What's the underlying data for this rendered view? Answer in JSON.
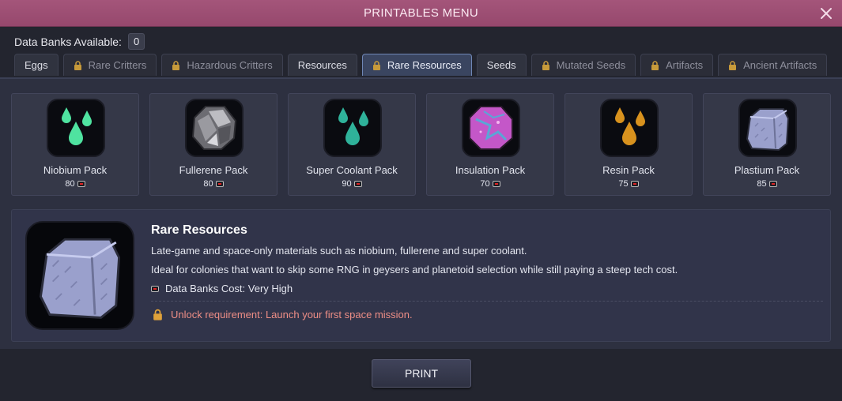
{
  "window": {
    "title": "PRINTABLES MENU"
  },
  "databanks": {
    "label": "Data Banks Available:",
    "count": "0"
  },
  "tabs": [
    {
      "label": "Eggs",
      "locked": false,
      "active": false
    },
    {
      "label": "Rare Critters",
      "locked": true,
      "active": false
    },
    {
      "label": "Hazardous Critters",
      "locked": true,
      "active": false
    },
    {
      "label": "Resources",
      "locked": false,
      "active": false
    },
    {
      "label": "Rare Resources",
      "locked": true,
      "active": true
    },
    {
      "label": "Seeds",
      "locked": false,
      "active": false
    },
    {
      "label": "Mutated Seeds",
      "locked": true,
      "active": false
    },
    {
      "label": "Artifacts",
      "locked": true,
      "active": false
    },
    {
      "label": "Ancient Artifacts",
      "locked": true,
      "active": false
    }
  ],
  "packs": [
    {
      "name": "Niobium Pack",
      "cost": "80",
      "icon": "green-drops-icon",
      "color": "#4fe3a0"
    },
    {
      "name": "Fullerene Pack",
      "cost": "80",
      "icon": "fullerene-rock-icon",
      "color": "#8a8a8f"
    },
    {
      "name": "Super Coolant Pack",
      "cost": "90",
      "icon": "teal-drops-icon",
      "color": "#2fb29a"
    },
    {
      "name": "Insulation Pack",
      "cost": "70",
      "icon": "insulation-crystal-icon",
      "color": "#c457c8"
    },
    {
      "name": "Resin Pack",
      "cost": "75",
      "icon": "amber-drops-icon",
      "color": "#d8921e"
    },
    {
      "name": "Plastium Pack",
      "cost": "85",
      "icon": "plastium-block-icon",
      "color": "#9aa0cc"
    }
  ],
  "details": {
    "title": "Rare Resources",
    "line1": "Late-game and space-only materials such as niobium, fullerene and super coolant.",
    "line2": "Ideal for colonies that want to skip some RNG in geysers and planetoid selection while still paying a steep tech cost.",
    "cost_text": "Data Banks Cost: Very High",
    "unlock_text": "Unlock requirement: Launch your first space mission."
  },
  "footer": {
    "print_label": "PRINT"
  },
  "colors": {
    "titlebar": "#9e4f75",
    "unlock_text": "#ee8e86",
    "active_tab_border": "#6f87b6"
  }
}
